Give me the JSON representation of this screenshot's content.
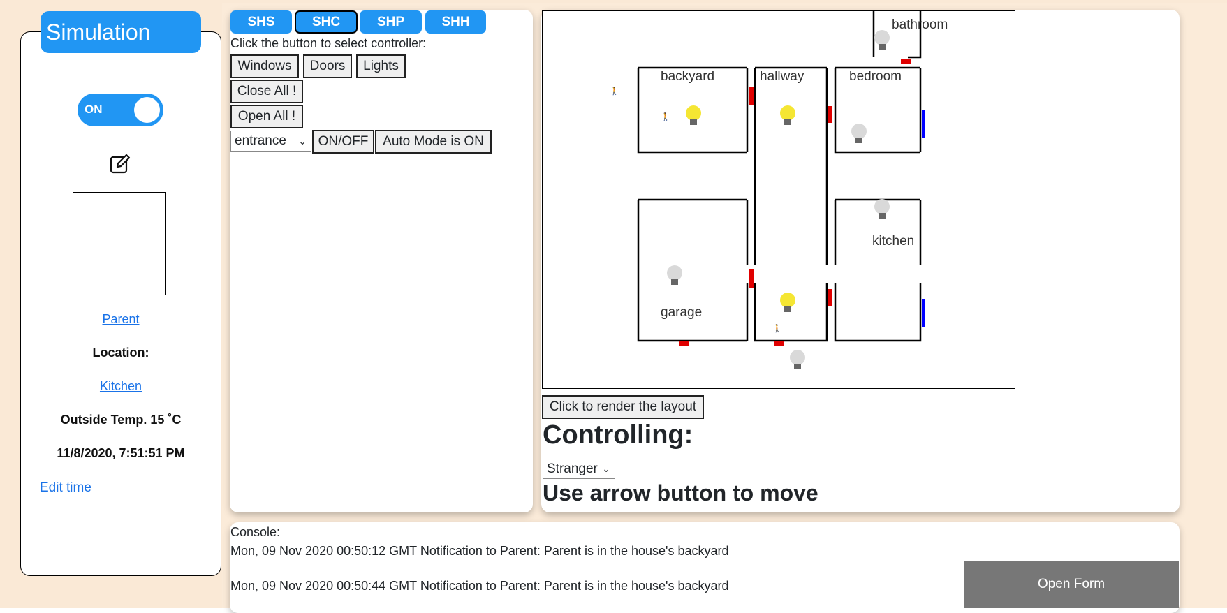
{
  "simulation": {
    "title": "Simulation",
    "toggle_label": "ON",
    "user_link": "Parent",
    "location_label": "Location:",
    "location_link": "Kitchen",
    "outside_temp": "Outside Temp. 15 ˚C",
    "datetime": "11/8/2020, 7:51:51 PM",
    "edit_time": "Edit time"
  },
  "controller": {
    "tabs": [
      {
        "label": "SHS",
        "active": false
      },
      {
        "label": "SHC",
        "active": true
      },
      {
        "label": "SHP",
        "active": false
      },
      {
        "label": "SHH",
        "active": false
      }
    ],
    "instruction": "Click the button to select controller:",
    "buttons": {
      "windows": "Windows",
      "doors": "Doors",
      "lights": "Lights",
      "close_all": "Close All !",
      "open_all": "Open All !",
      "on_off": "ON/OFF",
      "auto_mode": "Auto Mode is ON"
    },
    "selected_item": "entrance"
  },
  "layout": {
    "rooms": {
      "bathroom": "bathroom",
      "backyard": "backyard",
      "hallway": "hallway",
      "bedroom": "bedroom",
      "kitchen": "kitchen",
      "garage": "garage"
    },
    "render_button": "Click to render the layout",
    "controlling_heading": "Controlling:",
    "controlling_selected": "Stranger",
    "move_hint": "Use arrow button to move",
    "colors": {
      "door": "#e00000",
      "window": "#0000ff",
      "light_on": "#f5e633",
      "light_off": "#d9d9d9"
    }
  },
  "console": {
    "label": "Console:",
    "lines": [
      "Mon, 09 Nov 2020 00:50:12 GMT Notification to Parent: Parent is in the house's backyard",
      "Mon, 09 Nov 2020 00:50:44 GMT Notification to Parent: Parent is in the house's backyard"
    ]
  },
  "open_form_label": "Open Form"
}
